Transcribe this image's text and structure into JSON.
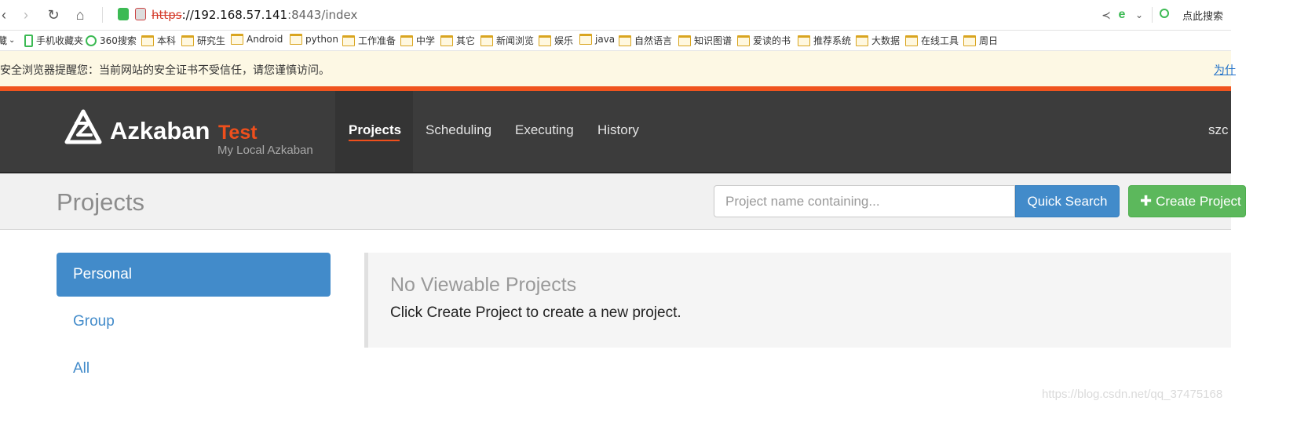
{
  "browser": {
    "url_protocol": "https",
    "url_host": "://192.168.57.141",
    "url_rest": ":8443/index",
    "search_label": "点此搜索",
    "bookmarks": [
      {
        "label": "藏",
        "icon": "chevron-down-icon"
      },
      {
        "label": "手机收藏夹",
        "icon": "phone-icon"
      },
      {
        "label": "360搜索",
        "icon": "360-search-icon"
      },
      {
        "label": "本科",
        "icon": "folder-icon"
      },
      {
        "label": "研究生",
        "icon": "folder-icon"
      },
      {
        "label": "Android",
        "icon": "folder-icon"
      },
      {
        "label": "python",
        "icon": "folder-icon"
      },
      {
        "label": "工作准备",
        "icon": "folder-icon"
      },
      {
        "label": "中学",
        "icon": "folder-icon"
      },
      {
        "label": "其它",
        "icon": "folder-icon"
      },
      {
        "label": "新闻浏览",
        "icon": "folder-icon"
      },
      {
        "label": "娱乐",
        "icon": "folder-icon"
      },
      {
        "label": "java",
        "icon": "folder-icon"
      },
      {
        "label": "自然语言",
        "icon": "folder-icon"
      },
      {
        "label": "知识图谱",
        "icon": "folder-icon"
      },
      {
        "label": "爱读的书",
        "icon": "folder-icon"
      },
      {
        "label": "推荐系统",
        "icon": "folder-icon"
      },
      {
        "label": "大数据",
        "icon": "folder-icon"
      },
      {
        "label": "在线工具",
        "icon": "folder-icon"
      },
      {
        "label": "周日",
        "icon": "folder-icon"
      }
    ],
    "security_warning": "安全浏览器提醒您：当前网站的安全证书不受信任，请您谨慎访问。",
    "security_link": "为什"
  },
  "app": {
    "brand_name": "Azkaban",
    "brand_env": "Test",
    "brand_subtitle": "My Local Azkaban",
    "nav": {
      "projects": "Projects",
      "scheduling": "Scheduling",
      "executing": "Executing",
      "history": "History"
    },
    "user": "szc",
    "accent_color": "#ef4f1c"
  },
  "page": {
    "title": "Projects",
    "search_placeholder": "Project name containing...",
    "quick_search": "Quick Search",
    "create_project": "Create Project"
  },
  "sidebar": {
    "items": [
      {
        "label": "Personal",
        "active": true
      },
      {
        "label": "Group",
        "active": false
      },
      {
        "label": "All",
        "active": false
      }
    ]
  },
  "content": {
    "empty_title": "No Viewable Projects",
    "empty_message": "Click Create Project to create a new project."
  },
  "watermark": "https://blog.csdn.net/qq_37475168"
}
